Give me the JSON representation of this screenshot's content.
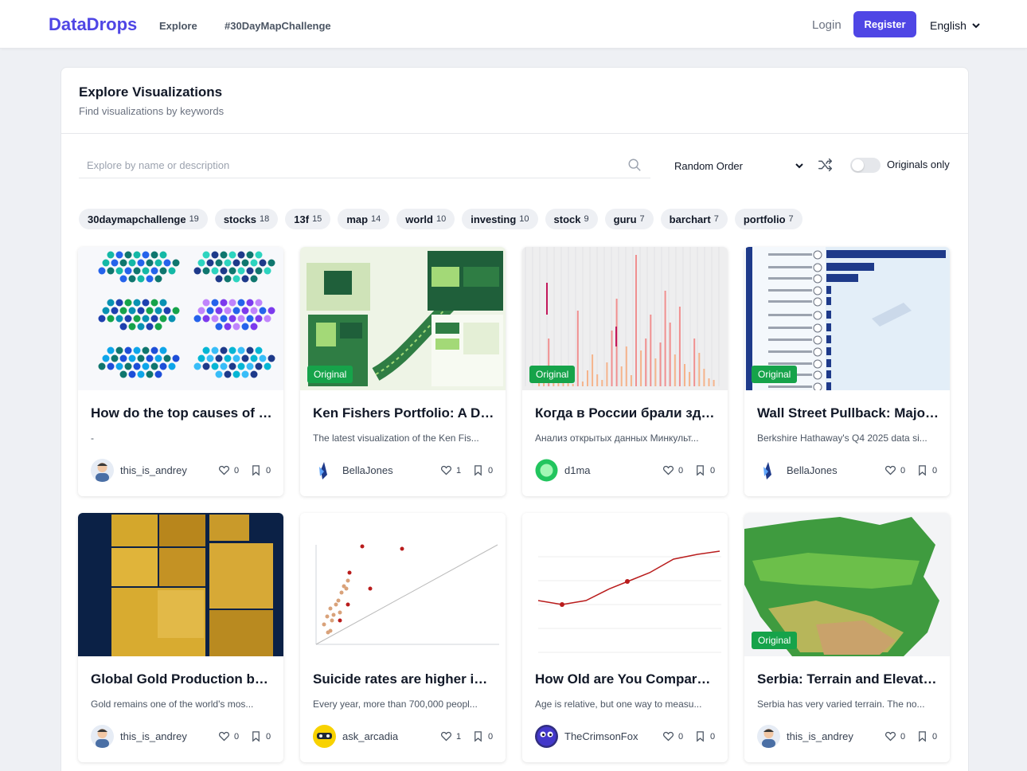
{
  "nav": {
    "brand": "DataDrops",
    "links": [
      "Explore",
      "#30DayMapChallenge"
    ],
    "login": "Login",
    "register": "Register",
    "language": "English"
  },
  "page": {
    "title": "Explore Visualizations",
    "subtitle": "Find visualizations by keywords"
  },
  "search": {
    "placeholder": "Explore by name or description",
    "value": ""
  },
  "order": {
    "selected": "Random Order"
  },
  "originals_toggle": {
    "label": "Originals only",
    "on": false
  },
  "tags": [
    {
      "name": "30daymapchallenge",
      "count": "19"
    },
    {
      "name": "stocks",
      "count": "18"
    },
    {
      "name": "13f",
      "count": "15"
    },
    {
      "name": "map",
      "count": "14"
    },
    {
      "name": "world",
      "count": "10"
    },
    {
      "name": "investing",
      "count": "10"
    },
    {
      "name": "stock",
      "count": "9"
    },
    {
      "name": "guru",
      "count": "7"
    },
    {
      "name": "barchart",
      "count": "7"
    },
    {
      "name": "portfolio",
      "count": "7"
    }
  ],
  "badge_label": "Original",
  "cards": [
    {
      "title": "How do the top causes of d...",
      "desc": "-",
      "author": "this_is_andrey",
      "likes": "0",
      "saves": "0",
      "original": false,
      "thumb": "hexmap",
      "avatar": "andrey"
    },
    {
      "title": "Ken Fishers Portfolio: A Dec...",
      "desc": "The latest visualization of the Ken Fis...",
      "author": "BellaJones",
      "likes": "1",
      "saves": "0",
      "original": true,
      "thumb": "infographic",
      "avatar": "bella"
    },
    {
      "title": "Когда в России брали здан...",
      "desc": "Анализ открытых данных Минкульт...",
      "author": "d1ma",
      "likes": "0",
      "saves": "0",
      "original": true,
      "thumb": "spikes",
      "avatar": "dima"
    },
    {
      "title": "Wall Street Pullback: Major ...",
      "desc": "Berkshire Hathaway's Q4 2025 data si...",
      "author": "BellaJones",
      "likes": "0",
      "saves": "0",
      "original": true,
      "thumb": "hbars",
      "avatar": "bella"
    },
    {
      "title": "Global Gold Production by ...",
      "desc": "Gold remains one of the world's mos...",
      "author": "this_is_andrey",
      "likes": "0",
      "saves": "0",
      "original": false,
      "thumb": "gold",
      "avatar": "andrey"
    },
    {
      "title": "Suicide rates are higher in ...",
      "desc": "Every year, more than 700,000 peopl...",
      "author": "ask_arcadia",
      "likes": "1",
      "saves": "0",
      "original": false,
      "thumb": "scatter",
      "avatar": "arcadia"
    },
    {
      "title": "How Old are You Compared...",
      "desc": "Age is relative, but one way to measu...",
      "author": "TheCrimsonFox",
      "likes": "0",
      "saves": "0",
      "original": false,
      "thumb": "agecurve",
      "avatar": "fox"
    },
    {
      "title": "Serbia: Terrain and Elevation",
      "desc": "Serbia has very varied terrain. The no...",
      "author": "this_is_andrey",
      "likes": "0",
      "saves": "0",
      "original": true,
      "thumb": "terrain",
      "avatar": "andrey"
    }
  ],
  "colors": {
    "brand": "#4f46e5",
    "original_badge": "#16a34a",
    "tag_bg": "#eef0f4"
  }
}
